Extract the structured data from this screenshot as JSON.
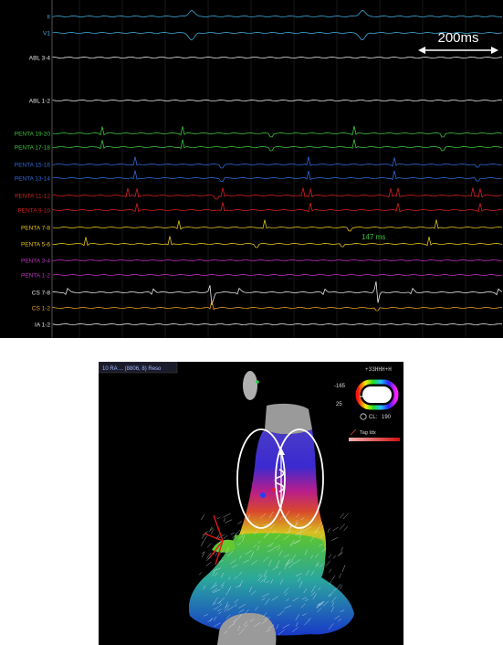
{
  "egm": {
    "scale_label": "200ms",
    "interval_label": "147 ms",
    "channels": [
      {
        "label": "II",
        "color": "#3fa8d8"
      },
      {
        "label": "V1",
        "color": "#3fa8d8"
      },
      {
        "label": "ABL 3-4",
        "color": "#e6e6e6"
      },
      {
        "label": "ABL 1-2",
        "color": "#e6e6e6"
      },
      {
        "label": "PENTA 19-20",
        "color": "#39c43a"
      },
      {
        "label": "PENTA 17-18",
        "color": "#39c43a"
      },
      {
        "label": "PENTA 15-16",
        "color": "#2f6ad8"
      },
      {
        "label": "PENTA 13-14",
        "color": "#2f6ad8"
      },
      {
        "label": "PENTA 11-12",
        "color": "#d42020"
      },
      {
        "label": "PENTA 9-10",
        "color": "#d42020"
      },
      {
        "label": "PENTA 7-8",
        "color": "#e2c21a"
      },
      {
        "label": "PENTA 5-6",
        "color": "#e2c21a"
      },
      {
        "label": "PENTA 3-4",
        "color": "#c02ec0"
      },
      {
        "label": "PENTA 1-2",
        "color": "#c02ec0"
      },
      {
        "label": "CS 7-8",
        "color": "#e6e6e6"
      },
      {
        "label": "CS 1-2",
        "color": "#e6a020"
      },
      {
        "label": "IA 1-2",
        "color": "#e6e6e6"
      }
    ]
  },
  "map": {
    "header_label": "10 RA ... (8806, 8) Reso",
    "header_right": "+33HHH+H",
    "scale_max": "-165",
    "scale_min": "25",
    "cl_label": "CL:",
    "cl_value": "190",
    "tag_label": "Tag Idx"
  },
  "colors": {
    "background": "#000000",
    "grid": "#333333"
  }
}
